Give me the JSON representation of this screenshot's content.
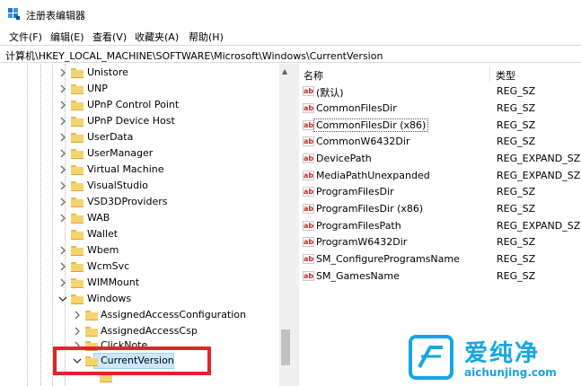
{
  "window": {
    "title": "注册表编辑器"
  },
  "menu": [
    "文件(F)",
    "编辑(E)",
    "查看(V)",
    "收藏夹(A)",
    "帮助(H)"
  ],
  "address": {
    "path": "计算机\\HKEY_LOCAL_MACHINE\\SOFTWARE\\Microsoft\\Windows\\CurrentVersion"
  },
  "tree": {
    "items": [
      {
        "label": "Unistore",
        "expanded": false
      },
      {
        "label": "UNP",
        "expanded": false
      },
      {
        "label": "UPnP Control Point",
        "expanded": false
      },
      {
        "label": "UPnP Device Host",
        "expanded": false
      },
      {
        "label": "UserData",
        "expanded": false
      },
      {
        "label": "UserManager",
        "expanded": false
      },
      {
        "label": "Virtual Machine",
        "expanded": false
      },
      {
        "label": "VisualStudio",
        "expanded": false
      },
      {
        "label": "VSD3DProviders",
        "expanded": false
      },
      {
        "label": "WAB",
        "expanded": false
      },
      {
        "label": "Wallet",
        "expanded": false
      },
      {
        "label": "Wbem",
        "expanded": false
      },
      {
        "label": "WcmSvc",
        "expanded": false
      },
      {
        "label": "WIMMount",
        "expanded": false
      },
      {
        "label": "Windows",
        "expanded": true
      },
      {
        "label": "AssignedAccessConfiguration",
        "expanded": false
      },
      {
        "label": "AssignedAccessCsp",
        "expanded": false
      },
      {
        "label": "ClickNote",
        "expanded": false
      },
      {
        "label": "CurrentVersion",
        "expanded": true,
        "selected": true
      }
    ]
  },
  "values": {
    "header": {
      "name": "名称",
      "type": "类型"
    },
    "rows": [
      {
        "name": "(默认)",
        "type": "REG_SZ"
      },
      {
        "name": "CommonFilesDir",
        "type": "REG_SZ"
      },
      {
        "name": "CommonFilesDir (x86)",
        "type": "REG_SZ",
        "focused": true
      },
      {
        "name": "CommonW6432Dir",
        "type": "REG_SZ"
      },
      {
        "name": "DevicePath",
        "type": "REG_EXPAND_SZ"
      },
      {
        "name": "MediaPathUnexpanded",
        "type": "REG_EXPAND_SZ"
      },
      {
        "name": "ProgramFilesDir",
        "type": "REG_SZ"
      },
      {
        "name": "ProgramFilesDir (x86)",
        "type": "REG_SZ"
      },
      {
        "name": "ProgramFilesPath",
        "type": "REG_EXPAND_SZ"
      },
      {
        "name": "ProgramW6432Dir",
        "type": "REG_SZ"
      },
      {
        "name": "SM_ConfigureProgramsName",
        "type": "REG_SZ"
      },
      {
        "name": "SM_GamesName",
        "type": "REG_SZ"
      }
    ]
  },
  "watermark": {
    "title": "爱纯净",
    "subtitle": "aichunjing.com"
  },
  "colors": {
    "highlight": "#e0242a",
    "folder": "#f6d36f",
    "watermark": "#16a5e3"
  }
}
